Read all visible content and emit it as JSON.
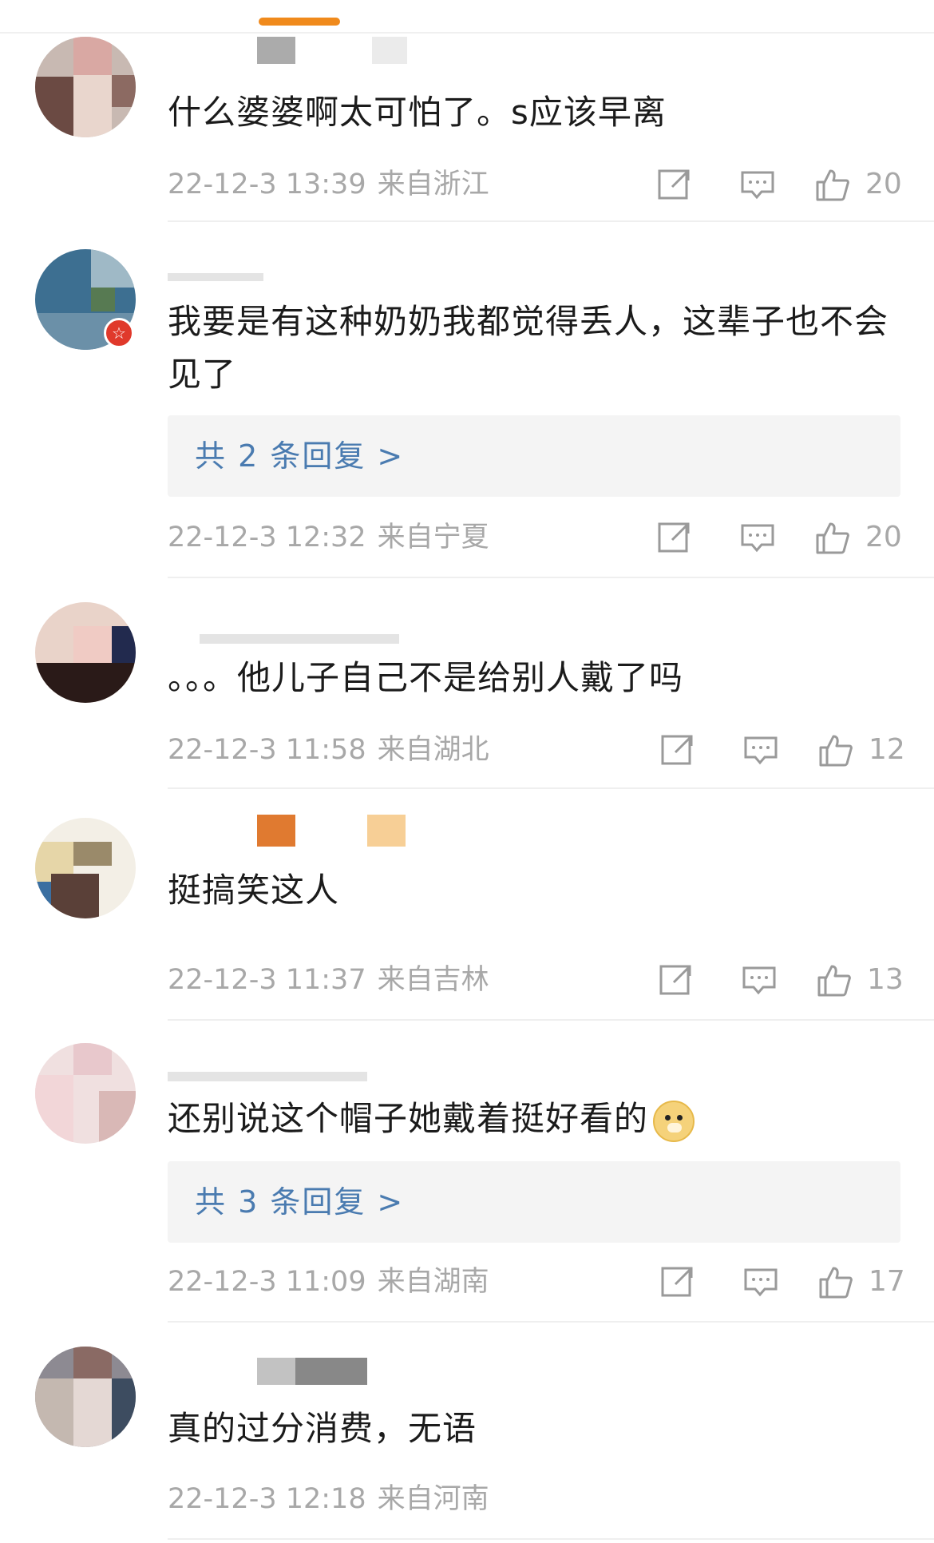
{
  "comments": [
    {
      "text": "什么婆婆啊太可怕了。s应该早离",
      "date": "22-12-3 13:39",
      "location": "来自浙江",
      "likes": "20",
      "reply_link": null
    },
    {
      "text": "我要是有这种奶奶我都觉得丢人，这辈子也不会见了",
      "date": "22-12-3 12:32",
      "location": "来自宁夏",
      "likes": "20",
      "reply_link": "共 2 条回复 >"
    },
    {
      "text": "。。。他儿子自己不是给别人戴了吗",
      "date": "22-12-3 11:58",
      "location": "来自湖北",
      "likes": "12",
      "reply_link": null
    },
    {
      "text": "挺搞笑这人",
      "date": "22-12-3 11:37",
      "location": "来自吉林",
      "likes": "13",
      "reply_link": null
    },
    {
      "text": "还别说这个帽子她戴着挺好看的",
      "date": "22-12-3 11:09",
      "location": "来自湖南",
      "likes": "17",
      "reply_link": "共 3 条回复 >",
      "emoji": "doge-emoji"
    },
    {
      "text": "真的过分消费，无语",
      "date": "22-12-3 12:18",
      "location": "来自河南",
      "likes": "",
      "reply_link": null
    }
  ],
  "icons": {
    "share": "share-icon",
    "comment": "comment-icon",
    "like": "like-icon",
    "verified": "verified-badge-icon"
  },
  "colors": {
    "accent": "#f08a1c",
    "link": "#4a7bb0",
    "meta": "#a8a8a8"
  }
}
